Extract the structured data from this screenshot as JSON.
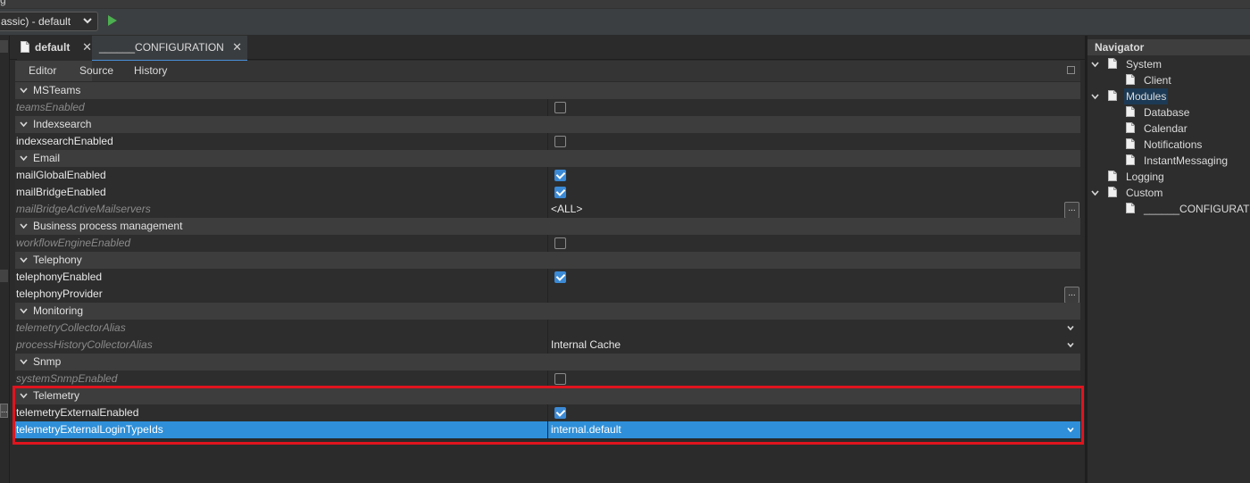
{
  "toolbar": {
    "run_config_value": "assic) - default",
    "run_icon": "play-icon",
    "top_glyph": "g"
  },
  "tabs": [
    {
      "label": "default",
      "icon": "file-icon",
      "close": "✕"
    },
    {
      "label": "______CONFIGURATION",
      "close": "✕"
    }
  ],
  "subtabs": [
    "Editor",
    "Source",
    "History"
  ],
  "gutter_button_label": "...",
  "grid": {
    "rows": [
      {
        "type": "category",
        "label": "MSTeams"
      },
      {
        "type": "prop",
        "name": "teamsEnabled",
        "disabled": true,
        "value_kind": "checkbox",
        "checked": false
      },
      {
        "type": "category",
        "label": "Indexsearch"
      },
      {
        "type": "prop",
        "name": "indexsearchEnabled",
        "disabled": false,
        "value_kind": "checkbox",
        "checked": false
      },
      {
        "type": "category",
        "label": "Email"
      },
      {
        "type": "prop",
        "name": "mailGlobalEnabled",
        "disabled": false,
        "value_kind": "checkbox",
        "checked": true
      },
      {
        "type": "prop",
        "name": "mailBridgeEnabled",
        "disabled": false,
        "value_kind": "checkbox",
        "checked": true
      },
      {
        "type": "prop",
        "name": "mailBridgeActiveMailservers",
        "disabled": true,
        "value_kind": "text",
        "value": "<ALL>",
        "ellipsis": "..."
      },
      {
        "type": "category",
        "label": "Business process management"
      },
      {
        "type": "prop",
        "name": "workflowEngineEnabled",
        "disabled": true,
        "value_kind": "checkbox",
        "checked": false
      },
      {
        "type": "category",
        "label": "Telephony"
      },
      {
        "type": "prop",
        "name": "telephonyEnabled",
        "disabled": false,
        "value_kind": "checkbox",
        "checked": true
      },
      {
        "type": "prop",
        "name": "telephonyProvider",
        "disabled": false,
        "value_kind": "text",
        "value": "",
        "ellipsis": "..."
      },
      {
        "type": "category",
        "label": "Monitoring"
      },
      {
        "type": "prop",
        "name": "telemetryCollectorAlias",
        "disabled": true,
        "value_kind": "dropdown",
        "value": ""
      },
      {
        "type": "prop",
        "name": "processHistoryCollectorAlias",
        "disabled": true,
        "value_kind": "dropdown",
        "value": "Internal Cache"
      },
      {
        "type": "category",
        "label": "Snmp"
      },
      {
        "type": "prop",
        "name": "systemSnmpEnabled",
        "disabled": true,
        "value_kind": "checkbox",
        "checked": false
      },
      {
        "type": "category",
        "label": "Telemetry"
      },
      {
        "type": "prop",
        "name": "telemetryExternalEnabled",
        "disabled": false,
        "value_kind": "checkbox",
        "checked": true
      },
      {
        "type": "prop",
        "name": "telemetryExternalLoginTypeIds",
        "disabled": false,
        "value_kind": "dropdown",
        "value": "internal.default",
        "selected": true
      }
    ]
  },
  "navigator": {
    "title": "Navigator",
    "items": [
      {
        "label": "System",
        "level": 0,
        "expanded": true
      },
      {
        "label": "Client",
        "level": 1
      },
      {
        "label": "Modules",
        "level": 0,
        "expanded": true,
        "selected": true
      },
      {
        "label": "Database",
        "level": 1
      },
      {
        "label": "Calendar",
        "level": 1
      },
      {
        "label": "Notifications",
        "level": 1
      },
      {
        "label": "InstantMessaging",
        "level": 1
      },
      {
        "label": "Logging",
        "level": 0
      },
      {
        "label": "Custom",
        "level": 0,
        "expanded": true
      },
      {
        "label": "______CONFIGURATI",
        "level": 1
      }
    ]
  },
  "colors": {
    "accent": "#2f8fd8",
    "checkbox_on": "#3b8ad6",
    "highlight_box": "#e0141e",
    "run_green": "#4caf50"
  }
}
